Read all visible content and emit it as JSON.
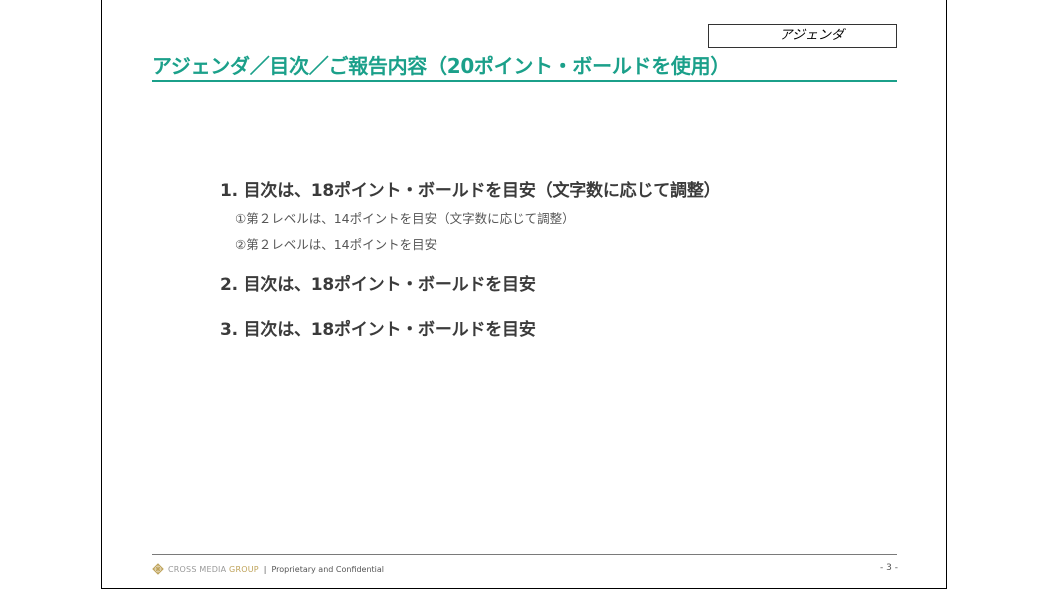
{
  "header": {
    "tag_label": "アジェンダ",
    "title": "アジェンダ／目次／ご報告内容（20ポイント・ボールドを使用）"
  },
  "agenda": {
    "items": [
      {
        "label": "1. 目次は、18ポイント・ボールドを目安（文字数に応じて調整）",
        "subitems": [
          "①第２レベルは、14ポイントを目安（文字数に応じて調整）",
          "②第２レベルは、14ポイントを目安"
        ]
      },
      {
        "label": "2. 目次は、18ポイント・ボールドを目安"
      },
      {
        "label": "3. 目次は、18ポイント・ボールドを目安"
      }
    ]
  },
  "footer": {
    "logo_text_main": "CROSS MEDIA ",
    "logo_text_accent": "GROUP",
    "separator": "|",
    "confidential": "Proprietary and Confidential",
    "page_number": "- 3 -"
  },
  "colors": {
    "accent": "#1ba08a",
    "logo_gold": "#bfa35a"
  },
  "icons": {
    "logo": "cross-media-group-logo-icon"
  }
}
